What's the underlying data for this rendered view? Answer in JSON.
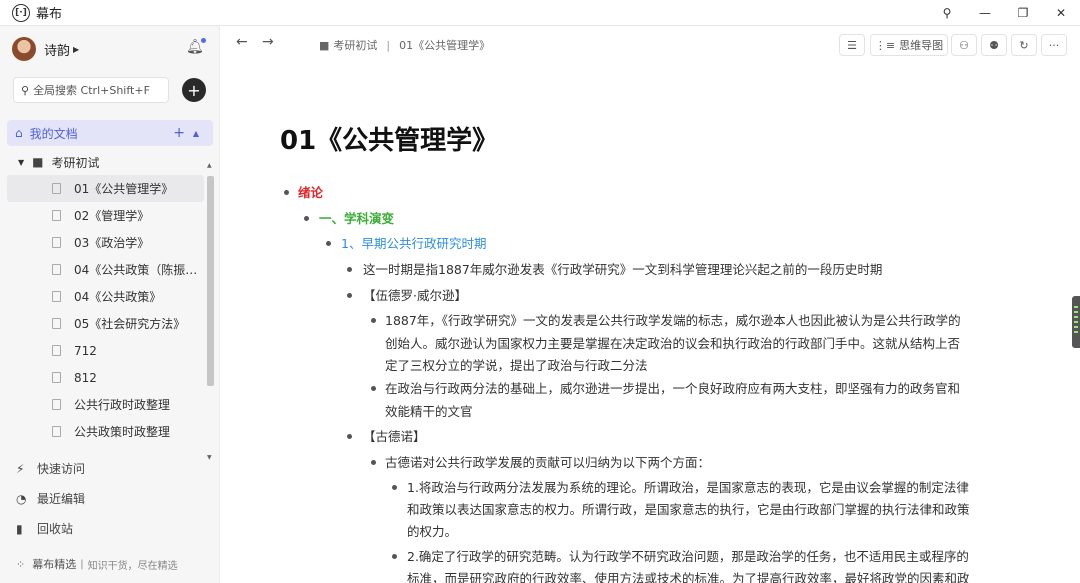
{
  "window": {
    "title": "幕布",
    "logo": "[·]",
    "buttons": [
      "pin-icon",
      "minimize-icon",
      "restore-icon",
      "close-icon"
    ]
  },
  "sidebar": {
    "user": "诗韵",
    "search_placeholder": "全局搜索 Ctrl+Shift+F",
    "my_docs": "我的文档",
    "folder": "考研初试",
    "docs": [
      "01《公共管理学》",
      "02《管理学》",
      "03《政治学》",
      "04《公共政策（陈振…",
      "04《公共政策》",
      "05《社会研究方法》",
      "712",
      "812",
      "公共行政时政整理",
      "公共政策时政整理"
    ],
    "nav": {
      "quick": "快速访问",
      "recent": "最近编辑",
      "trash": "回收站"
    },
    "footer": {
      "title": "幕布精选",
      "sep": "|",
      "subtitle": "知识干货，尽在精选"
    }
  },
  "topbar": {
    "breadcrumb_folder": "考研初试",
    "breadcrumb_sep": "|",
    "breadcrumb_doc": "01《公共管理学》",
    "mindmap_label": "思维导图"
  },
  "document": {
    "title": "01《公共管理学》",
    "colors": {
      "red": "#e0282d",
      "green": "#3aae35",
      "blue": "#2f8fdf"
    },
    "lines": [
      "绪论",
      "一、学科演变",
      "1、早期公共行政研究时期",
      "这一时期是指1887年威尔逊发表《行政学研究》一文到科学管理理论兴起之前的一段历史时期",
      "【伍德罗·威尔逊】",
      "1887年，《行政学研究》一文的发表是公共行政学发端的标志，威尔逊本人也因此被认为是公共行政学的",
      "创始人。威尔逊认为国家权力主要是掌握在决定政治的议会和执行政治的行政部门手中。这就从结构上否",
      "定了三权分立的学说，提出了政治与行政二分法",
      "在政治与行政两分法的基础上，威尔逊进一步提出，一个良好政府应有两大支柱，即坚强有力的政务官和",
      "效能精干的文官",
      "【古德诺】",
      "古德诺对公共行政学发展的贡献可以归纳为以下两个方面：",
      "1.将政治与行政两分法发展为系统的理论。所谓政治，是国家意志的表现，它是由议会掌握的制定法律",
      "和政策以表达国家意志的权力。所谓行政，是国家意志的执行，它是由行政部门掌握的执行法律和政策",
      "的权力。",
      "2.确定了行政学的研究范畴。认为行政学不研究政治问题，那是政治学的任务，也不适用民主或程序的",
      "标准，而是研究政府的行政效率、使用方法或技术的标准。为了提高行政效率，最好将政党的因素和政"
    ]
  }
}
